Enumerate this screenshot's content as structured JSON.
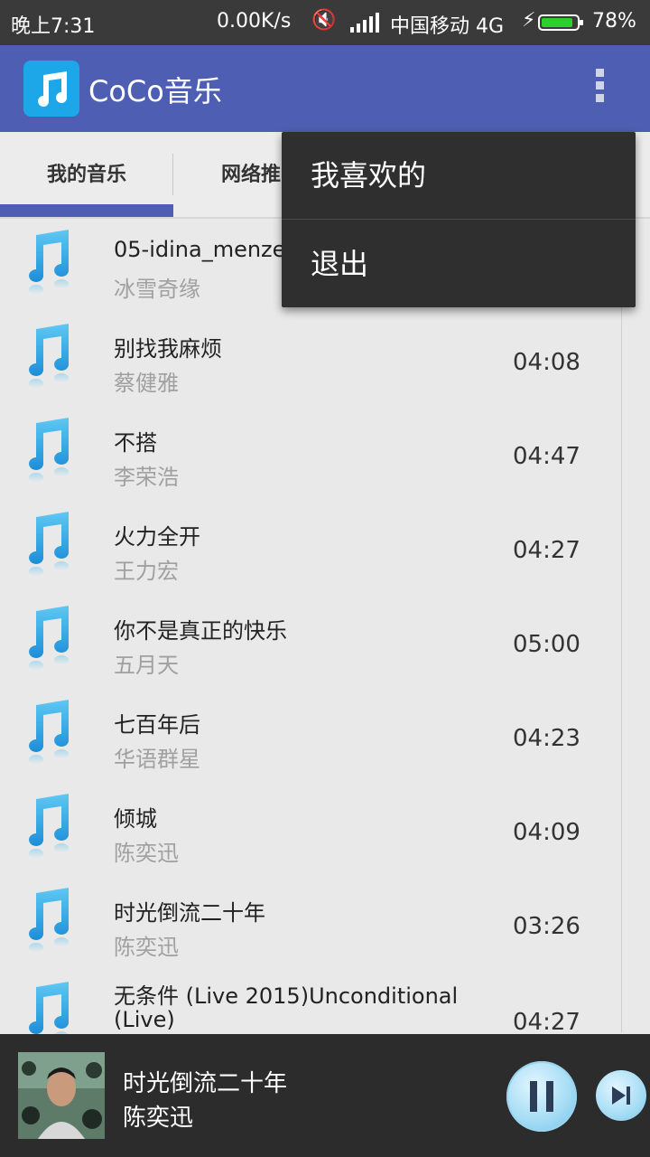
{
  "status_bar": {
    "time": "晚上7:31",
    "net_speed": "0.00K/s",
    "carrier": "中国移动 4G",
    "battery": "78%",
    "battery_level": 0.78
  },
  "app_bar": {
    "title": "CoCo音乐",
    "brand_color": "#4e5fb3"
  },
  "tabs": [
    {
      "label": "我的音乐",
      "selected": true
    },
    {
      "label": "网络推",
      "selected": false
    }
  ],
  "dropdown_menu": {
    "items": [
      "我喜欢的",
      "退出"
    ]
  },
  "songs": [
    {
      "title": "05-idina_menze",
      "artist": "冰雪奇缘",
      "duration": ""
    },
    {
      "title": "别找我麻烦",
      "artist": "蔡健雅",
      "duration": "04:08"
    },
    {
      "title": "不搭",
      "artist": "李荣浩",
      "duration": "04:47"
    },
    {
      "title": "火力全开",
      "artist": "王力宏",
      "duration": "04:27"
    },
    {
      "title": "你不是真正的快乐",
      "artist": "五月天",
      "duration": "05:00"
    },
    {
      "title": "七百年后",
      "artist": "华语群星",
      "duration": "04:23"
    },
    {
      "title": "倾城",
      "artist": "陈奕迅",
      "duration": "04:09"
    },
    {
      "title": "时光倒流二十年",
      "artist": "陈奕迅",
      "duration": "03:26"
    },
    {
      "title": "无条件 (Live 2015)Unconditional",
      "title_line2": "(Live)",
      "artist": "",
      "duration": "04:27"
    }
  ],
  "now_playing": {
    "title": "时光倒流二十年",
    "artist": "陈奕迅"
  },
  "icons": {
    "app_logo": "music-note-icon",
    "song": "music-note-icon",
    "menu": "overflow-menu-icon",
    "pause": "pause-icon",
    "next": "skip-next-icon"
  }
}
